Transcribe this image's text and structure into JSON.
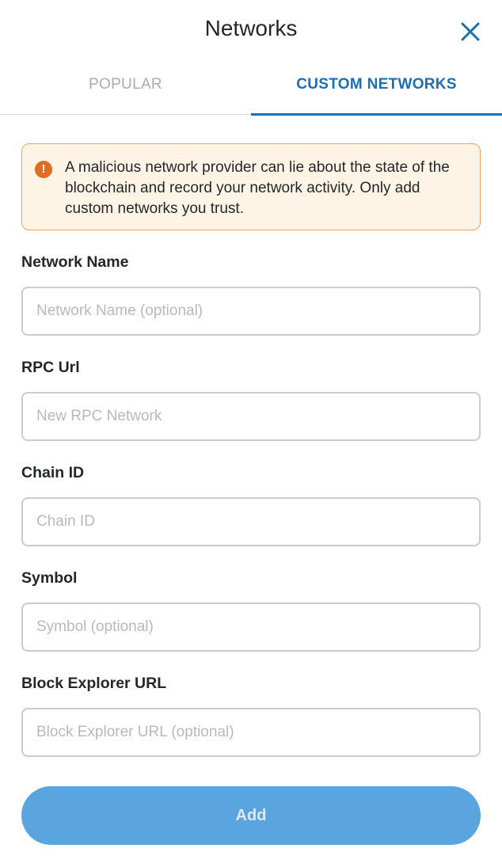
{
  "header": {
    "title": "Networks",
    "close_icon": "close-icon"
  },
  "tabs": [
    {
      "label": "POPULAR",
      "active": false
    },
    {
      "label": "CUSTOM NETWORKS",
      "active": true
    }
  ],
  "warning": {
    "icon": "exclamation-circle-icon",
    "icon_glyph": "!",
    "text": "A malicious network provider can lie about the state of the blockchain and record your network activity. Only add custom networks you trust."
  },
  "form": {
    "fields": [
      {
        "label": "Network Name",
        "value": "",
        "placeholder": "Network Name (optional)"
      },
      {
        "label": "RPC Url",
        "value": "",
        "placeholder": "New RPC Network"
      },
      {
        "label": "Chain ID",
        "value": "",
        "placeholder": "Chain ID"
      },
      {
        "label": "Symbol",
        "value": "",
        "placeholder": "Symbol (optional)"
      },
      {
        "label": "Block Explorer URL",
        "value": "",
        "placeholder": "Block Explorer URL (optional)"
      }
    ],
    "submit_label": "Add"
  },
  "colors": {
    "accent": "#1a6fb5",
    "warning_border": "#f0a35b",
    "warning_bg": "#fef4e6",
    "warning_icon": "#e06e1e",
    "button_disabled": "#5aa5df"
  }
}
